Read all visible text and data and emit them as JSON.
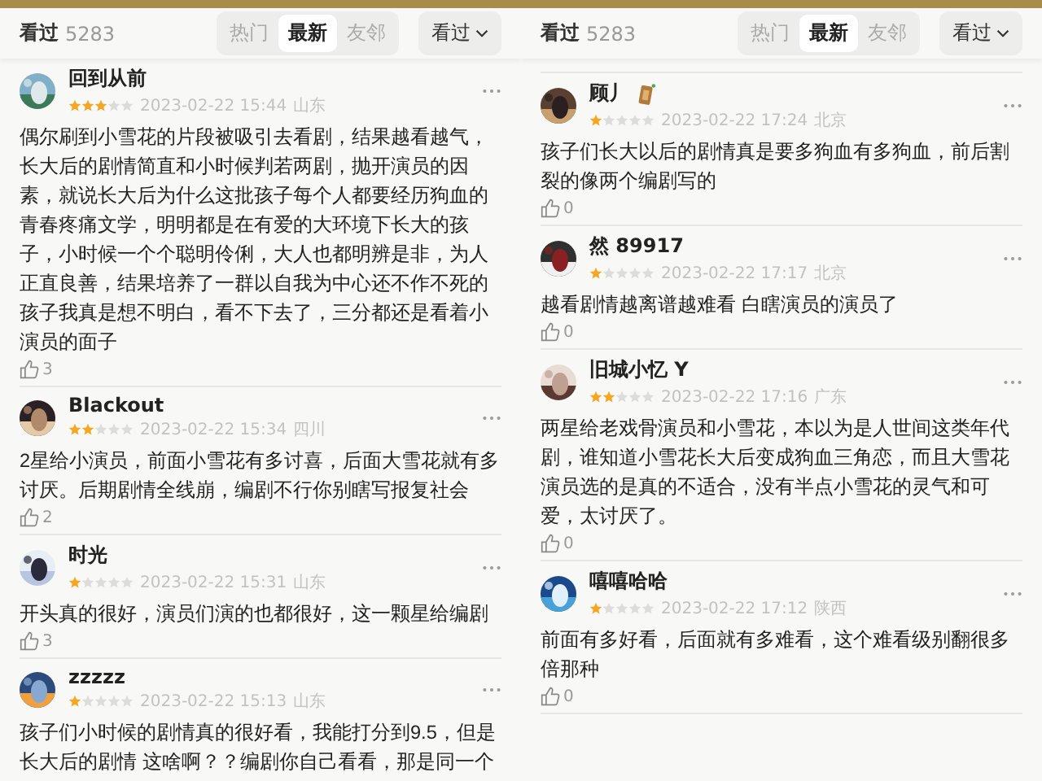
{
  "panels": [
    {
      "header": {
        "label": "看过",
        "count": "5283"
      },
      "tabs": [
        {
          "label": "热门",
          "selected": false
        },
        {
          "label": "最新",
          "selected": true
        },
        {
          "label": "友邻",
          "selected": false
        }
      ],
      "filter": {
        "label": "看过"
      },
      "scrolled": false,
      "reviews": [
        {
          "name": "回到从前",
          "badge": false,
          "stars": 3,
          "date": "2023-02-22 15:44",
          "location": "山东",
          "text": "偶尔刷到小雪花的片段被吸引去看剧，结果越看越气，长大后的剧情简直和小时候判若两剧，抛开演员的因素，就说长大后为什么这批孩子每个人都要经历狗血的青春疼痛文学，明明都是在有爱的大环境下长大的孩子，小时候一个个聪明伶俐，大人也都明辨是非，为人正直良善，结果培养了一群以自我为中心还不作不死的孩子我真是想不明白，看不下去了，三分都还是看着小演员的面子",
          "likes": "3"
        },
        {
          "name": "Blackout",
          "badge": false,
          "stars": 2,
          "date": "2023-02-22 15:34",
          "location": "四川",
          "text": "2星给小演员，前面小雪花有多讨喜，后面大雪花就有多讨厌。后期剧情全线崩，编剧不行你别瞎写报复社会",
          "likes": "2"
        },
        {
          "name": "时光",
          "badge": false,
          "stars": 1,
          "date": "2023-02-22 15:31",
          "location": "山东",
          "text": "开头真的很好，演员们演的也都很好，这一颗星给编剧",
          "likes": "3"
        },
        {
          "name": "zzzzz",
          "badge": false,
          "stars": 1,
          "date": "2023-02-22 15:13",
          "location": "山东",
          "text": "孩子们小时候的剧情真的很好看，我能打分到9.5，但是长大后的剧情 这啥啊？？编剧你自己看看，那是同一个"
        }
      ]
    },
    {
      "header": {
        "label": "看过",
        "count": "5283"
      },
      "tabs": [
        {
          "label": "热门",
          "selected": false
        },
        {
          "label": "最新",
          "selected": true
        },
        {
          "label": "友邻",
          "selected": false
        }
      ],
      "filter": {
        "label": "看过"
      },
      "scrolled": true,
      "reviews": [
        {
          "name": "顾丿",
          "badge": true,
          "stars": 1,
          "date": "2023-02-22 17:24",
          "location": "北京",
          "text": "孩子们长大以后的剧情真是要多狗血有多狗血，前后割裂的像两个编剧写的",
          "likes": "0"
        },
        {
          "name": "然 89917",
          "badge": false,
          "stars": 1,
          "date": "2023-02-22 17:17",
          "location": "北京",
          "text": "越看剧情越离谱越难看 白瞎演员的演员了",
          "likes": "0"
        },
        {
          "name": "旧城小忆 Y",
          "badge": false,
          "stars": 2,
          "date": "2023-02-22 17:16",
          "location": "广东",
          "text": "两星给老戏骨演员和小雪花，本以为是人世间这类年代剧，谁知道小雪花长大后变成狗血三角恋，而且大雪花演员选的是真的不适合，没有半点小雪花的灵气和可爱，太讨厌了。",
          "likes": "0"
        },
        {
          "name": "嘻嘻哈哈",
          "badge": false,
          "stars": 1,
          "date": "2023-02-22 17:12",
          "location": "陕西",
          "text": "前面有多好看，后面就有多难看，这个难看级别翻很多倍那种",
          "likes": "0"
        }
      ]
    }
  ]
}
